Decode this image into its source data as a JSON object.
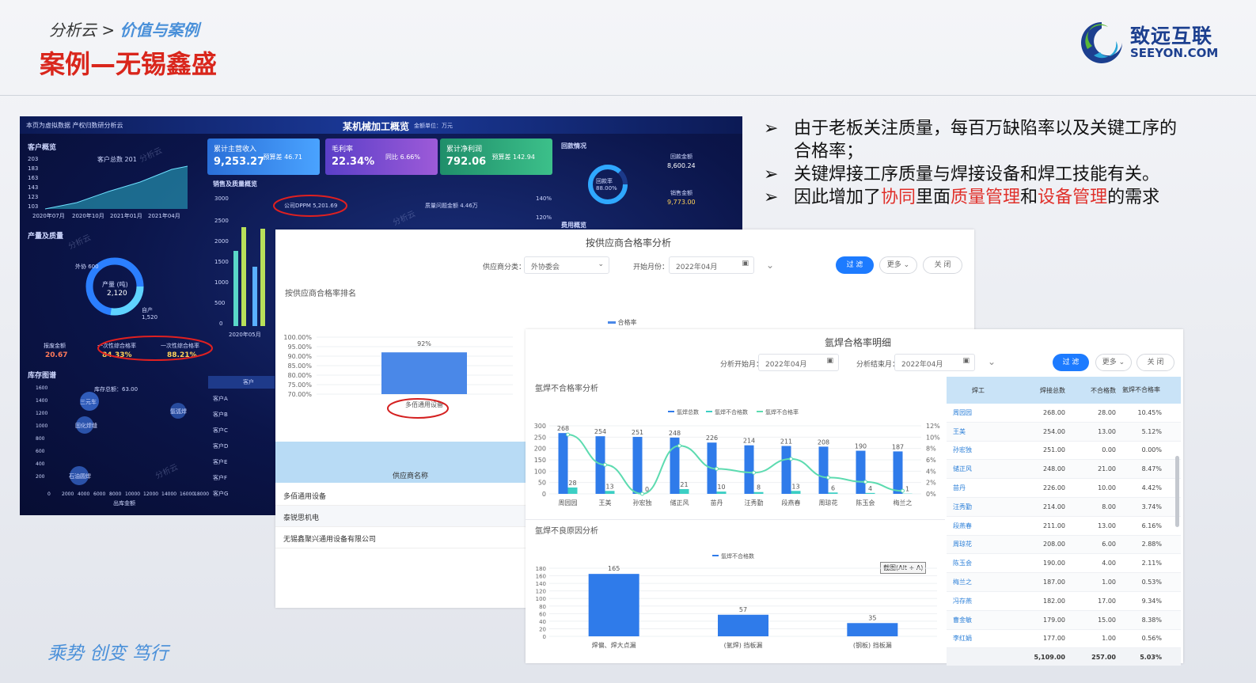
{
  "slide": {
    "breadcrumb_prefix": "分析云 >",
    "breadcrumb_active": "价值与案例",
    "title": "案例—无锡鑫盛",
    "slogan": "乘势 创变 笃行",
    "logo_cn": "致远互联",
    "logo_en": "SEEYON.COM",
    "bullet_marker": "➢",
    "bullet1": "由于老板关注质量，每百万缺陷率以及关键工序的合格率；",
    "bullet2": "关键焊接工序质量与焊接设备和焊工技能有关。",
    "bullet3_a": "因此增加了",
    "bullet3_b": "协同",
    "bullet3_c": "里面",
    "bullet3_d": "质量管理",
    "bullet3_e": "和",
    "bullet3_f": "设备管理",
    "bullet3_g": "的需求"
  },
  "dashboard": {
    "header_note": "本页为虚拟数据 产权归数研分析云",
    "title": "某机械加工概览",
    "unit": "金额单位：万元",
    "sec_customer": "客户概览",
    "sec_production": "产量及质量",
    "sec_inventory": "库存图谱",
    "sec_sales": "销售及质量概览",
    "sec_payment": "回款情况",
    "sec_cost": "费用概览",
    "customer_total": "客户总数 201",
    "kpi1_label": "累计主营收入",
    "kpi1_value": "9,253.27",
    "kpi1_sub": "预算差 46.71",
    "kpi2_label": "毛利率",
    "kpi2_value": "22.34%",
    "kpi2_sub": "同比 6.66%",
    "kpi3_label": "累计净利润",
    "kpi3_value": "792.06",
    "kpi3_sub": "预算差 142.94",
    "donut_center": "产量 (吨)",
    "donut_value": "2,120",
    "waixie": "外协 600",
    "zichan": "自产 1,520",
    "scrap_label": "报废金额",
    "scrap_value": "20.67",
    "pass1_label": "一次性综合格率",
    "pass1_value": "84.33%",
    "pass2_label": "一次性综合格率",
    "pass2_value": "88.21%",
    "ppm": "公司DPPM 5,201.69",
    "payment_center": "回款率 88.00%",
    "payment_amt_label": "回款金额",
    "payment_amt": "8,600.24",
    "sales_amt_label": "销售金额",
    "sales_amt": "9,773.00",
    "inventory_total": "库存总额：63.00",
    "bubble1": "三元车",
    "bubble2": "固化焊缝",
    "bubble3": "氩弧焊",
    "bubble4": "石油圆焊",
    "inv_xlabel": "出库金额",
    "bar_yticks": [
      "3000",
      "2500",
      "2000",
      "1500",
      "1000",
      "500",
      "0"
    ],
    "pct_ticks": [
      "140%",
      "120%"
    ],
    "cust_xticks": [
      "2020年07月",
      "2020年10月",
      "2021年01月",
      "2021年04月"
    ],
    "cust_yticks": [
      "203",
      "183",
      "163",
      "143",
      "123",
      "103"
    ],
    "inv_yticks": [
      "1600",
      "1400",
      "1200",
      "1000",
      "800",
      "600",
      "400",
      "200"
    ],
    "inv_xticks": [
      "0",
      "2000",
      "4000",
      "6000",
      "8000",
      "10000",
      "12000",
      "14000",
      "16000",
      "18000"
    ],
    "bar_xlabel": "2020年05月",
    "cust_col": "客户",
    "customers": [
      "客户A",
      "客户B",
      "客户C",
      "客户D",
      "客户E",
      "客户F",
      "客户G"
    ],
    "watermark": "分析云",
    "sales_defect_label": "质量问题金额 4.46万"
  },
  "panel1": {
    "title": "按供应商合格率分析",
    "filter_label1": "供应商分类：",
    "filter_value1": "外协委会",
    "filter_label2": "开始月份：",
    "filter_value2": "2022年04月",
    "btn_filter": "过 滤",
    "btn_more": "更多",
    "btn_close": "关 闭",
    "chart_title": "按供应商合格率排名",
    "legend": "合格率",
    "table_header": "供应商名称",
    "suppliers": [
      "多佰通用设备",
      "泰锐思机电",
      "无锡鑫聚兴通用设备有限公司"
    ]
  },
  "panel2": {
    "title": "氩焊合格率明细",
    "filter_label1": "分析开始月：",
    "filter_value1": "2022年04月",
    "filter_label2": "分析结束月：",
    "filter_value2": "2022年04月",
    "btn_filter": "过 滤",
    "btn_more": "更多",
    "btn_close": "关 闭",
    "chart1_title": "氩焊不合格率分析",
    "chart2_title": "氩焊不良原因分析",
    "screenshot_hint": "截图(Alt + A)",
    "col_welder": "焊工",
    "col_total": "焊接总数",
    "col_bad": "不合格数",
    "col_rate": "氩焊不合格率",
    "rows": [
      {
        "name": "周园园",
        "total": "268.00",
        "bad": "28.00",
        "rate": "10.45%"
      },
      {
        "name": "王美",
        "total": "254.00",
        "bad": "13.00",
        "rate": "5.12%"
      },
      {
        "name": "孙宏独",
        "total": "251.00",
        "bad": "0.00",
        "rate": "0.00%"
      },
      {
        "name": "储正风",
        "total": "248.00",
        "bad": "21.00",
        "rate": "8.47%"
      },
      {
        "name": "苗丹",
        "total": "226.00",
        "bad": "10.00",
        "rate": "4.42%"
      },
      {
        "name": "汪秀勤",
        "total": "214.00",
        "bad": "8.00",
        "rate": "3.74%"
      },
      {
        "name": "段燕春",
        "total": "211.00",
        "bad": "13.00",
        "rate": "6.16%"
      },
      {
        "name": "周琼花",
        "total": "208.00",
        "bad": "6.00",
        "rate": "2.88%"
      },
      {
        "name": "陈玉会",
        "total": "190.00",
        "bad": "4.00",
        "rate": "2.11%"
      },
      {
        "name": "梅兰之",
        "total": "187.00",
        "bad": "1.00",
        "rate": "0.53%"
      },
      {
        "name": "冯存燕",
        "total": "182.00",
        "bad": "17.00",
        "rate": "9.34%"
      },
      {
        "name": "曹金敏",
        "total": "179.00",
        "bad": "15.00",
        "rate": "8.38%"
      },
      {
        "name": "李红娟",
        "total": "177.00",
        "bad": "1.00",
        "rate": "0.56%"
      }
    ],
    "totals": {
      "total": "5,109.00",
      "bad": "257.00",
      "rate": "5.03%"
    }
  },
  "chart_data": [
    {
      "type": "bar",
      "title": "按供应商合格率排名",
      "categories": [
        "多佰通用设备"
      ],
      "series": [
        {
          "name": "合格率",
          "values": [
            92
          ]
        }
      ],
      "data_labels": [
        "92%"
      ],
      "ylim": [
        70,
        100
      ],
      "yticks": [
        "100.00%",
        "95.00%",
        "90.00%",
        "85.00%",
        "80.00%",
        "75.00%",
        "70.00%"
      ]
    },
    {
      "type": "bar",
      "title": "氩焊不合格率分析",
      "categories": [
        "周园园",
        "王美",
        "孙宏独",
        "储正风",
        "苗丹",
        "汪秀勤",
        "段燕春",
        "周琼花",
        "陈玉会",
        "梅兰之"
      ],
      "series": [
        {
          "name": "氩焊总数",
          "values": [
            268,
            254,
            251,
            248,
            226,
            214,
            211,
            208,
            190,
            187
          ]
        },
        {
          "name": "氩焊不合格数",
          "values": [
            28,
            13,
            0,
            21,
            10,
            8,
            13,
            6,
            4,
            1
          ]
        },
        {
          "name": "氩焊不合格率",
          "values": [
            10.45,
            5.12,
            0,
            8.47,
            4.42,
            3.74,
            6.16,
            2.88,
            2.11,
            0.53
          ]
        }
      ],
      "ylim": [
        0,
        300
      ],
      "y2lim": [
        0,
        12
      ],
      "yticks": [
        "300",
        "250",
        "200",
        "150",
        "100",
        "50",
        "0"
      ],
      "y2ticks": [
        "12%",
        "10%",
        "8%",
        "6%",
        "4%",
        "2%",
        "0%"
      ]
    },
    {
      "type": "bar",
      "title": "氩焊不良原因分析",
      "categories": [
        "焊偏、焊大点漏",
        "(氩焊) 挡板漏",
        "(钢板) 挡板漏"
      ],
      "series": [
        {
          "name": "氩焊不合格数",
          "values": [
            165,
            57,
            35
          ]
        }
      ],
      "ylim": [
        0,
        180
      ],
      "yticks": [
        "180",
        "160",
        "140",
        "120",
        "100",
        "80",
        "60",
        "40",
        "20",
        "0"
      ]
    }
  ]
}
